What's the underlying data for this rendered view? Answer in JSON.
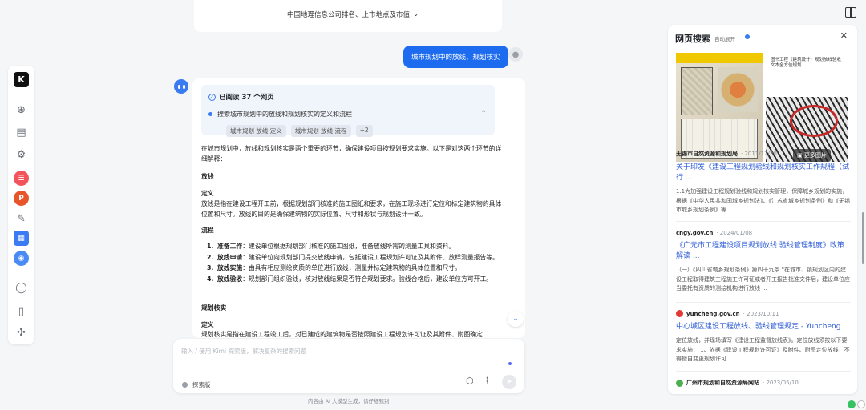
{
  "header": {
    "title": "中国地理信息公司排名、上市地点及市值",
    "dropdown_icon": "chevron-down-icon"
  },
  "sidebar": {
    "logo": "K",
    "items": [
      {
        "icon": "new-chat-icon"
      },
      {
        "icon": "history-icon"
      },
      {
        "icon": "explore-icon"
      },
      {
        "icon": "app-red-icon",
        "color": "#f2545b"
      },
      {
        "icon": "app-ppt-icon",
        "text": "P",
        "color": "#e8552b"
      },
      {
        "icon": "pen-icon"
      },
      {
        "icon": "app-blue-icon",
        "color": "#3a7af2"
      },
      {
        "icon": "app-blue2-icon",
        "color": "#4a8af4"
      },
      {
        "icon": "user-icon"
      },
      {
        "icon": "phone-icon"
      },
      {
        "icon": "puzzle-icon"
      }
    ]
  },
  "chat": {
    "user_message": "城市规划中的放线、规划核实",
    "sources": {
      "read_label": "已阅读 37 个网页",
      "query": "搜索城市规划中的放线和规划核实的定义和流程",
      "tags": [
        "城市规划 放线 定义",
        "城市规划 放线 流程",
        "+2"
      ]
    },
    "intro": "在城市规划中，放线和规划核实是两个重要的环节，确保建设项目按规划要求实施。以下是对这两个环节的详细解释：",
    "section1_title": "放线",
    "def_label": "定义",
    "def_text": "放线是指在建设工程开工前，根据规划部门核准的施工图纸和要求，在施工现场进行定位和标定建筑物的具体位置和尺寸。放线的目的是确保建筑物的实际位置、尺寸和形状与规划设计一致。",
    "process_label": "流程",
    "steps": [
      {
        "n": "1.",
        "title": "准备工作",
        "text": "：建设单位根据规划部门核准的施工图纸，准备放线所需的测量工具和资料。"
      },
      {
        "n": "2.",
        "title": "放线申请",
        "text": "：建设单位向规划部门提交放线申请，包括建设工程规划许可证及其附件、放样测量报告等。"
      },
      {
        "n": "3.",
        "title": "放线实施",
        "text": "：由具有相应测绘资质的单位进行放线，测量并标定建筑物的具体位置和尺寸。"
      },
      {
        "n": "4.",
        "title": "放线验收",
        "text": "：规划部门组织验线，核对放线结果是否符合规划要求。验线合格后，建设单位方可开工。"
      }
    ],
    "section2_title": "规划核实",
    "def2_label": "定义",
    "def2_text": "规划核实是指在建设工程竣工后，对已建成的建筑物是否按照建设工程规划许可证及其附件、附图确定"
  },
  "input": {
    "placeholder": "输入 / 使用 Kimi 探索版，解决复杂的搜索问题",
    "mode_label": "探索版"
  },
  "disclaimer": "内容由 AI 大模型生成，请仔细甄别",
  "web_panel": {
    "title": "网页搜索",
    "auto_expand": "自动展开",
    "more_images": "更多图片",
    "thumb_caption": "图书工程（建筑设计）规划放线验收文本全方位规划",
    "results": [
      {
        "source": "无锡市自然资源和规划局",
        "date": "· 2011/12/30",
        "title": "关于印发《建设工程规划验线和规划核实工作规程（试行 ...",
        "snippet": "1.1为加强建设工程规划验线和规划核实管理，保障城乡规划的实施，根据《中华人民共和国城乡规划法》、《江苏省城乡规划条例》和《无锡市城乡规划条例》等 ..."
      },
      {
        "source": "cngy.gov.cn",
        "date": "· 2024/01/08",
        "title": "《广元市工程建设项目规划放线 验线管理制度》政策解读 ...",
        "snippet": "（一）《四川省城乡规划条例》第四十九条 \"在城市、镇规划区内的建设工程取得建筑工程施工许可证或者开工报告批准文件后，建设单位应当委托有资质的测绘机构进行放线 ..."
      },
      {
        "source": "yuncheng.gov.cn",
        "date": "· 2023/10/11",
        "title": "中心城区建设工程放线、验线管理规定 - Yuncheng",
        "snippet": "定位放线，并现场填写《建设工程监督放线表》。定位放线须按以下要求实施： 1、依据《建设工程规划许可证》及附件、附图定位放线，不得擅自变更规划许可 ..."
      },
      {
        "source": "广州市规划和自然资源局网站",
        "date": "· 2023/05/10"
      }
    ]
  }
}
